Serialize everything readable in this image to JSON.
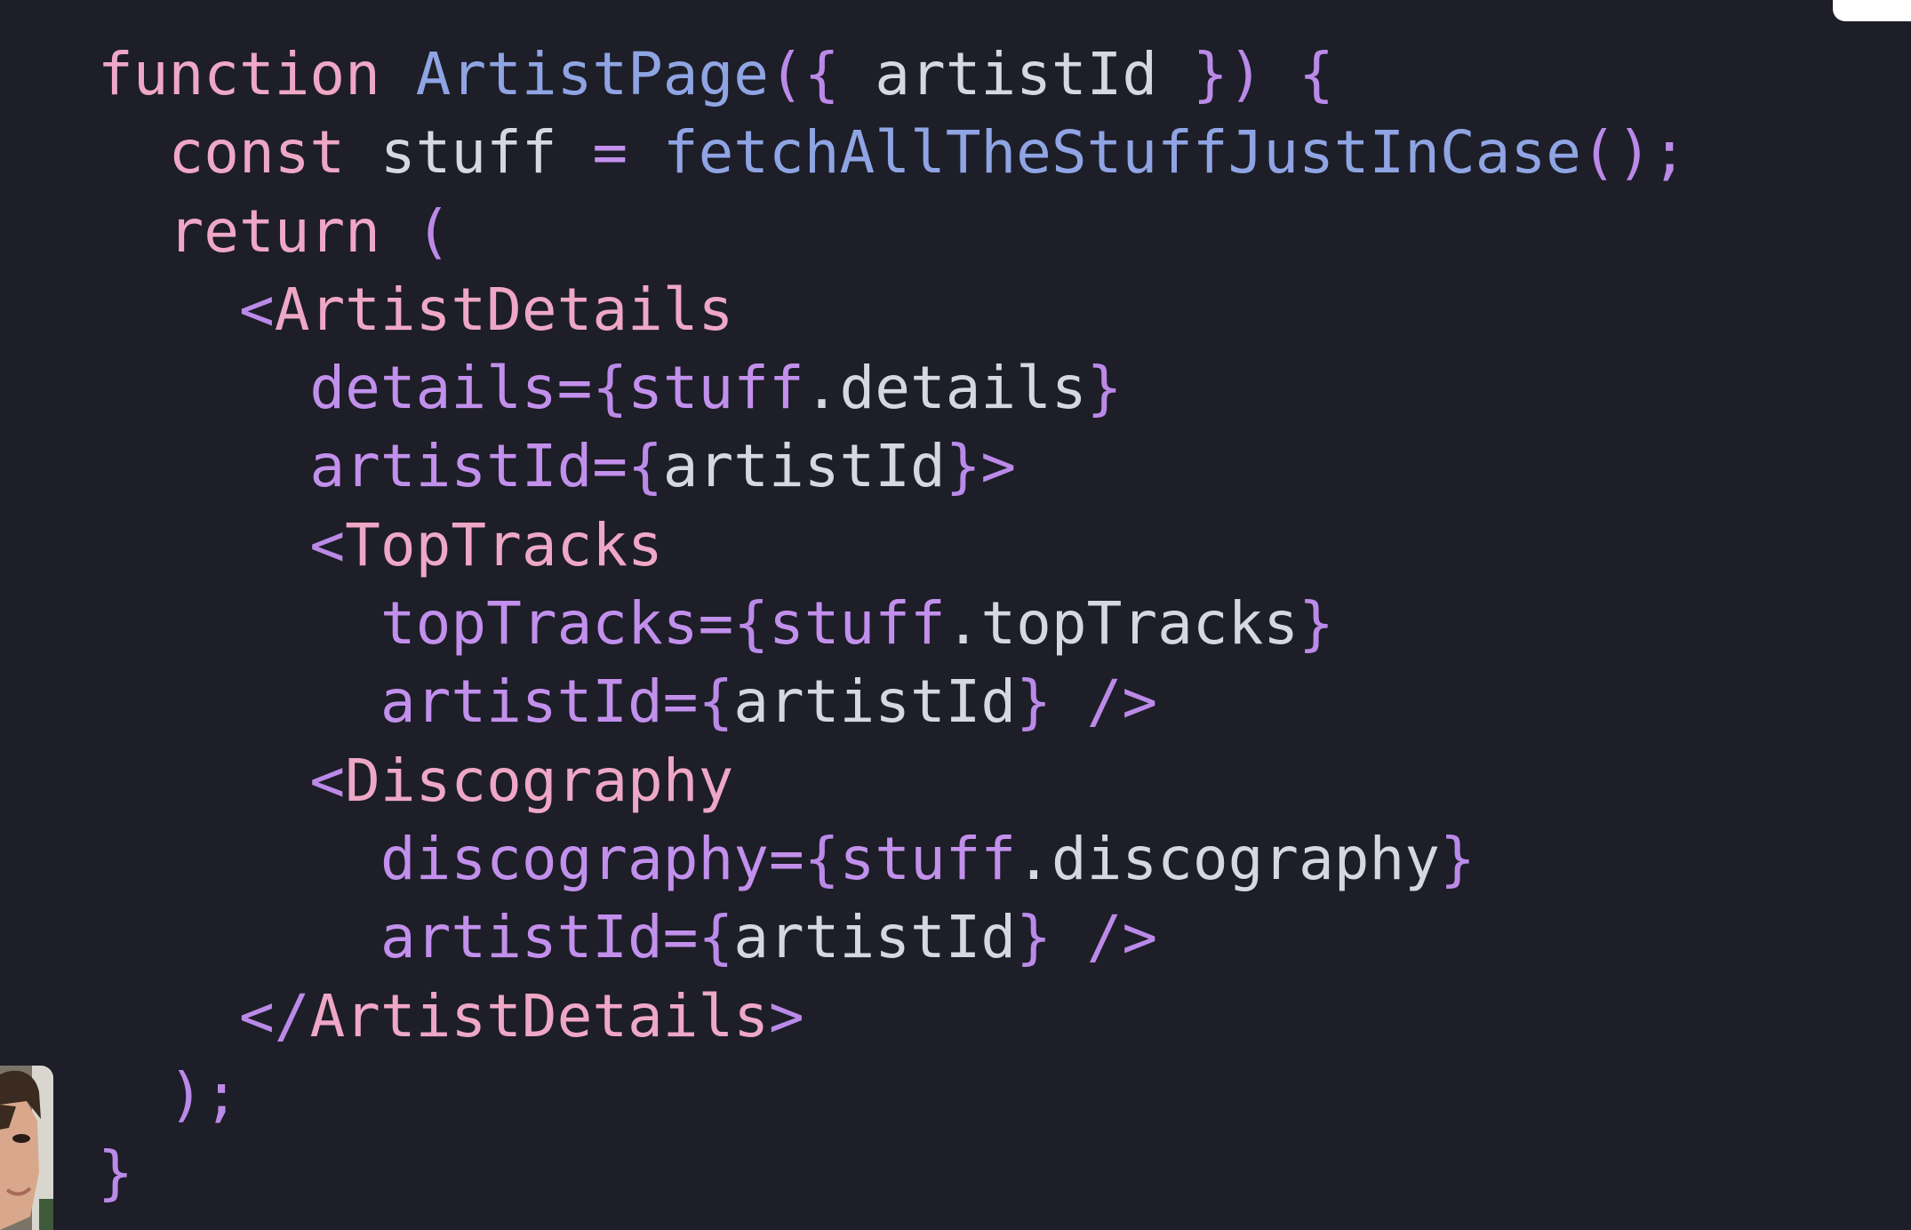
{
  "code": {
    "language": "jsx",
    "lines": [
      [
        {
          "t": "function",
          "c": "kw"
        },
        {
          "t": " ",
          "c": "tx"
        },
        {
          "t": "ArtistPage",
          "c": "fn"
        },
        {
          "t": "({",
          "c": "pn"
        },
        {
          "t": " artistId ",
          "c": "tx"
        },
        {
          "t": "})",
          "c": "pn"
        },
        {
          "t": " ",
          "c": "tx"
        },
        {
          "t": "{",
          "c": "pn"
        }
      ],
      [
        {
          "t": "  ",
          "c": "tx"
        },
        {
          "t": "const",
          "c": "kw"
        },
        {
          "t": " stuff ",
          "c": "tx"
        },
        {
          "t": "=",
          "c": "at"
        },
        {
          "t": " ",
          "c": "tx"
        },
        {
          "t": "fetchAllTheStuffJustInCase",
          "c": "fn"
        },
        {
          "t": "();",
          "c": "pn"
        }
      ],
      [
        {
          "t": "  ",
          "c": "tx"
        },
        {
          "t": "return",
          "c": "kw"
        },
        {
          "t": " ",
          "c": "tx"
        },
        {
          "t": "(",
          "c": "pn"
        }
      ],
      [
        {
          "t": "    ",
          "c": "tx"
        },
        {
          "t": "<",
          "c": "pn"
        },
        {
          "t": "ArtistDetails",
          "c": "tg"
        }
      ],
      [
        {
          "t": "      ",
          "c": "tx"
        },
        {
          "t": "details=",
          "c": "at"
        },
        {
          "t": "{",
          "c": "pn"
        },
        {
          "t": "stuff",
          "c": "at"
        },
        {
          "t": ".details",
          "c": "tx"
        },
        {
          "t": "}",
          "c": "pn"
        }
      ],
      [
        {
          "t": "      ",
          "c": "tx"
        },
        {
          "t": "artistId=",
          "c": "at"
        },
        {
          "t": "{",
          "c": "pn"
        },
        {
          "t": "artistId",
          "c": "tx"
        },
        {
          "t": "}>",
          "c": "pn"
        }
      ],
      [
        {
          "t": "      ",
          "c": "tx"
        },
        {
          "t": "<",
          "c": "pn"
        },
        {
          "t": "TopTracks",
          "c": "tg"
        }
      ],
      [
        {
          "t": "        ",
          "c": "tx"
        },
        {
          "t": "topTracks=",
          "c": "at"
        },
        {
          "t": "{",
          "c": "pn"
        },
        {
          "t": "stuff",
          "c": "at"
        },
        {
          "t": ".topTracks",
          "c": "tx"
        },
        {
          "t": "}",
          "c": "pn"
        }
      ],
      [
        {
          "t": "        ",
          "c": "tx"
        },
        {
          "t": "artistId=",
          "c": "at"
        },
        {
          "t": "{",
          "c": "pn"
        },
        {
          "t": "artistId",
          "c": "tx"
        },
        {
          "t": "}",
          "c": "pn"
        },
        {
          "t": " ",
          "c": "tx"
        },
        {
          "t": "/>",
          "c": "pn"
        }
      ],
      [
        {
          "t": "      ",
          "c": "tx"
        },
        {
          "t": "<",
          "c": "pn"
        },
        {
          "t": "Discography",
          "c": "tg"
        }
      ],
      [
        {
          "t": "        ",
          "c": "tx"
        },
        {
          "t": "discography=",
          "c": "at"
        },
        {
          "t": "{",
          "c": "pn"
        },
        {
          "t": "stuff",
          "c": "at"
        },
        {
          "t": ".discography",
          "c": "tx"
        },
        {
          "t": "}",
          "c": "pn"
        }
      ],
      [
        {
          "t": "        ",
          "c": "tx"
        },
        {
          "t": "artistId=",
          "c": "at"
        },
        {
          "t": "{",
          "c": "pn"
        },
        {
          "t": "artistId",
          "c": "tx"
        },
        {
          "t": "}",
          "c": "pn"
        },
        {
          "t": " ",
          "c": "tx"
        },
        {
          "t": "/>",
          "c": "pn"
        }
      ],
      [
        {
          "t": "    ",
          "c": "tx"
        },
        {
          "t": "</",
          "c": "pn"
        },
        {
          "t": "ArtistDetails",
          "c": "tg"
        },
        {
          "t": ">",
          "c": "pn"
        }
      ],
      [
        {
          "t": "  ",
          "c": "tx"
        },
        {
          "t": ");",
          "c": "pn"
        }
      ],
      [
        {
          "t": "}",
          "c": "pn"
        }
      ]
    ]
  },
  "colors": {
    "background": "#1d1e28",
    "keyword": "#efa7c6",
    "function": "#8fa4e3",
    "punctuation": "#bb8ae8",
    "tag": "#efa7c6",
    "attribute": "#c290ec",
    "text": "#d6d7e0"
  },
  "overlays": {
    "webcam_icon": "presenter-webcam-thumbnail",
    "corner_tab_icon": "white-corner-tab"
  }
}
